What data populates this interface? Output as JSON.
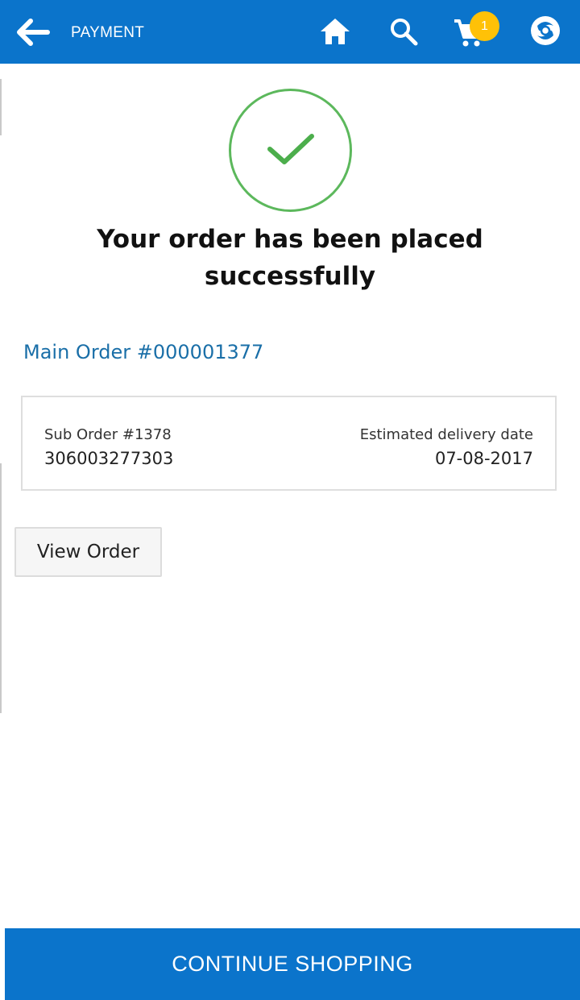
{
  "appbar": {
    "title": "PAYMENT",
    "back_icon": "arrow-left-icon",
    "home_icon": "home-icon",
    "search_icon": "search-icon",
    "cart_icon": "cart-icon",
    "cart_count": "1",
    "brand_icon": "brand-logo-icon",
    "bar_color": "#0b74cb",
    "badge_color": "#ffc107"
  },
  "confirmation": {
    "status_icon": "check-circle-icon",
    "status_color": "#5cb85c",
    "message": "Your order has been placed successfully"
  },
  "order": {
    "main_order": "Main Order #000001377",
    "sub_order_label": "Sub Order #1378",
    "sub_order_value": "306003277303",
    "delivery_label": "Estimated delivery date",
    "delivery_date": "07-08-2017"
  },
  "actions": {
    "view_order_label": "View Order",
    "continue_label": "CONTINUE SHOPPING"
  }
}
